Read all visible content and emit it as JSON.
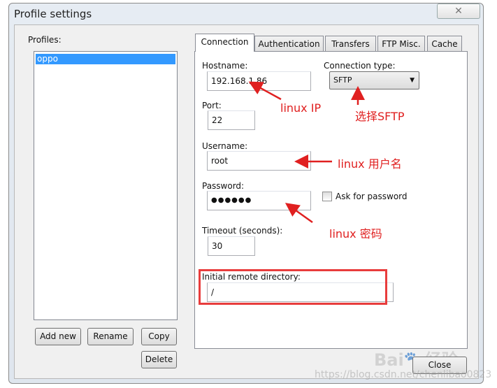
{
  "window": {
    "title": "Profile settings",
    "close_icon": "close-x-icon"
  },
  "profiles": {
    "label": "Profiles:",
    "items": [
      "oppo"
    ],
    "selected": "oppo",
    "buttons": {
      "add_new": "Add new",
      "rename": "Rename",
      "copy": "Copy",
      "delete": "Delete"
    }
  },
  "tabs": [
    {
      "label": "Connection",
      "active": true
    },
    {
      "label": "Authentication"
    },
    {
      "label": "Transfers"
    },
    {
      "label": "FTP Misc."
    },
    {
      "label": "Cache"
    }
  ],
  "connection": {
    "hostname_label": "Hostname:",
    "hostname": "192.168.1.86",
    "connection_type_label": "Connection type:",
    "connection_type": "SFTP",
    "port_label": "Port:",
    "port": "22",
    "username_label": "Username:",
    "username": "root",
    "password_label": "Password:",
    "password": "●●●●●●",
    "ask_password_label": "Ask for password",
    "ask_password": false,
    "timeout_label": "Timeout (seconds):",
    "timeout": "30",
    "initial_dir_label": "Initial remote directory:",
    "initial_dir": "/"
  },
  "close_label": "Close",
  "annotations": {
    "ip": "linux IP",
    "sftp": "选择SFTP",
    "user": "linux 用户名",
    "pass": "linux 密码",
    "color": "#e02020"
  },
  "watermark": {
    "baidu": "Bai 经验",
    "url": "https://blog.csdn.net/chenlibao0823"
  }
}
